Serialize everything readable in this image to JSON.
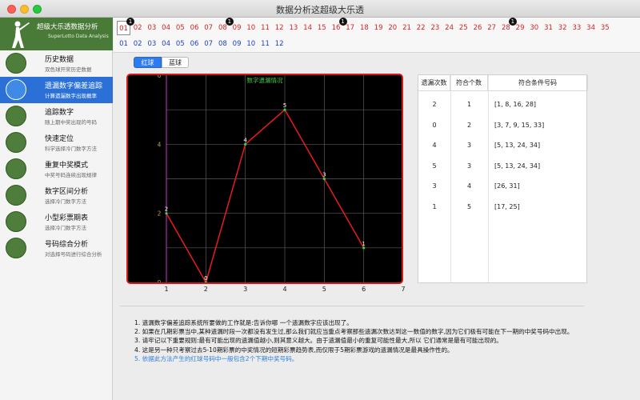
{
  "window": {
    "title": "数据分析这超级大乐透"
  },
  "logo": {
    "title": "超级大乐透数据分析",
    "subtitle": "SuperLotto Data Analysis"
  },
  "menu": [
    {
      "title": "历史数据",
      "sub": "双色球开奖历史数据",
      "icon": "clock-icon",
      "selected": false
    },
    {
      "title": "遗漏数字偏差追踪",
      "sub": "计算遗漏数字出现概率",
      "icon": "scatter-icon",
      "selected": true
    },
    {
      "title": "追踪数字",
      "sub": "随上期中奖出现的号码",
      "icon": "track-icon",
      "selected": false
    },
    {
      "title": "快速定位",
      "sub": "科学选择冷门数字方法",
      "icon": "locate-icon",
      "selected": false
    },
    {
      "title": "重复中奖模式",
      "sub": "中奖号码连续出现规律",
      "icon": "repeat-icon",
      "selected": false
    },
    {
      "title": "数字区间分析",
      "sub": "选择冷门数字方法",
      "icon": "interval-icon",
      "selected": false
    },
    {
      "title": "小型彩票期表",
      "sub": "选择冷门数字方法",
      "icon": "table-icon",
      "selected": false
    },
    {
      "title": "号码综合分析",
      "sub": "对选择号码进行综合分析",
      "icon": "analysis-icon",
      "selected": false
    }
  ],
  "red_numbers": [
    "01",
    "02",
    "03",
    "04",
    "05",
    "06",
    "07",
    "08",
    "09",
    "10",
    "11",
    "12",
    "13",
    "14",
    "15",
    "16",
    "17",
    "18",
    "19",
    "20",
    "21",
    "22",
    "23",
    "24",
    "25",
    "26",
    "27",
    "28",
    "29",
    "30",
    "31",
    "32",
    "33",
    "34",
    "35"
  ],
  "blue_numbers": [
    "01",
    "02",
    "03",
    "04",
    "05",
    "06",
    "07",
    "08",
    "09",
    "10",
    "11",
    "12"
  ],
  "boxed_red": [
    "01"
  ],
  "badges": [
    {
      "number": "01",
      "label": "1"
    },
    {
      "number": "08",
      "label": "1"
    },
    {
      "number": "16",
      "label": "1"
    },
    {
      "number": "28",
      "label": "1"
    }
  ],
  "tabs": {
    "red": "红球",
    "blue": "蓝球",
    "selected": "red"
  },
  "colors": {
    "accent": "#2d7bf0",
    "line": "#e81c1c",
    "chart_bg": "#000000",
    "red_num": "#d81e1e",
    "blue_num": "#1d3fc0"
  },
  "chart_data": {
    "type": "line",
    "title": "数字遗漏情况",
    "x": [
      1,
      2,
      3,
      4,
      5,
      6
    ],
    "values": [
      2,
      0,
      4,
      5,
      3,
      1
    ],
    "xlim": [
      1,
      7
    ],
    "ylim": [
      0,
      6
    ],
    "x_ticks": [
      "1",
      "2",
      "3",
      "4",
      "5",
      "6",
      "7"
    ],
    "y_ticks": [
      "0",
      "2",
      "4",
      "6"
    ],
    "grid": true
  },
  "table": {
    "headers": [
      "遗漏次数",
      "符合个数",
      "符合条件号码"
    ],
    "rows": [
      [
        "2",
        "1",
        "[1, 8, 16, 28]"
      ],
      [
        "0",
        "2",
        "[3, 7, 9, 15, 33]"
      ],
      [
        "4",
        "3",
        "[5, 13, 24, 34]"
      ],
      [
        "5",
        "3",
        "[5, 13, 24, 34]"
      ],
      [
        "3",
        "4",
        "[26, 31]"
      ],
      [
        "1",
        "5",
        "[17, 25]"
      ]
    ]
  },
  "notes": [
    "1. 遗漏数字偏差追踪系统所要做的工作就是:告诉你哪 一个遗漏数字应该出现了。",
    "2. 如果在几期彩票当中,某种遗漏时段一次都没有发生过,那么我们就应当重点考察那些遗漏次数达到这一数值的数字,因为它们极有可能在下一期的中奖号码中出现。",
    "3. 请牢记以下重要规则:最有可能出现的遗漏值越小,则其意义越大。由于遗漏值最小的重复可能性最大,所以 它们通常是最有可能出现的。",
    "4. 这是另一种只考察过去5-10期彩票的中奖情况的短期彩票趋势表,而仅限于5期彩票游戏的遗漏情况是最具操作性的。",
    "5. 依据此方法产生的红球号码中一般包含2个下期中奖号码。"
  ]
}
